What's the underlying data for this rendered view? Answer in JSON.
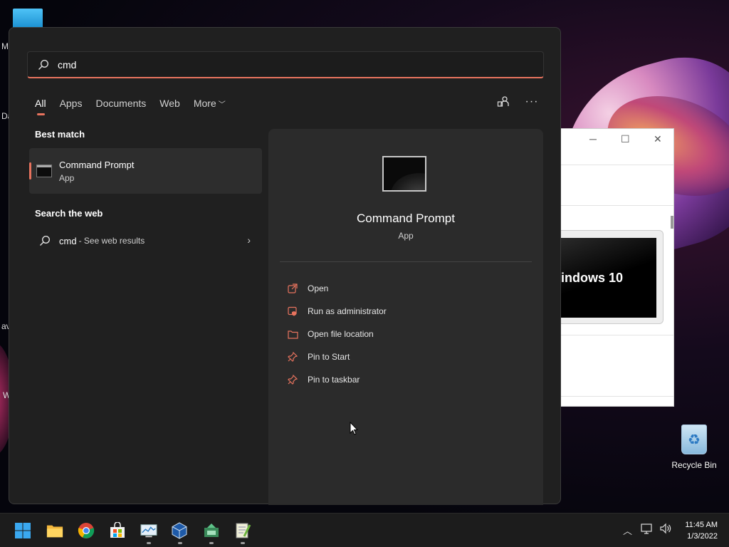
{
  "desktop": {
    "edge_letters": [
      "M",
      "Da",
      "av",
      "W"
    ],
    "recycle_bin_label": "Recycle Bin",
    "bg_window_banner_text": "indows 10"
  },
  "search": {
    "query": "cmd",
    "tabs": [
      {
        "label": "All",
        "active": true
      },
      {
        "label": "Apps"
      },
      {
        "label": "Documents"
      },
      {
        "label": "Web"
      },
      {
        "label": "More",
        "has_chevron": true
      }
    ]
  },
  "results": {
    "best_match_title": "Best match",
    "best_match": {
      "name": "Command Prompt",
      "type": "App"
    },
    "web_title": "Search the web",
    "web_item": {
      "query": "cmd",
      "suffix": "- See web results"
    }
  },
  "preview": {
    "name": "Command Prompt",
    "type": "App",
    "actions": [
      {
        "label": "Open",
        "icon": "open-external-icon"
      },
      {
        "label": "Run as administrator",
        "icon": "shield-admin-icon"
      },
      {
        "label": "Open file location",
        "icon": "folder-icon"
      },
      {
        "label": "Pin to Start",
        "icon": "pin-icon"
      },
      {
        "label": "Pin to taskbar",
        "icon": "pin-icon"
      }
    ]
  },
  "taskbar": {
    "time": "11:45 AM",
    "date": "1/3/2022"
  },
  "colors": {
    "accent": "#e8735e",
    "panel_bg": "#202020",
    "preview_bg": "#2b2b2b",
    "taskbar_bg": "#1c1c1c"
  }
}
